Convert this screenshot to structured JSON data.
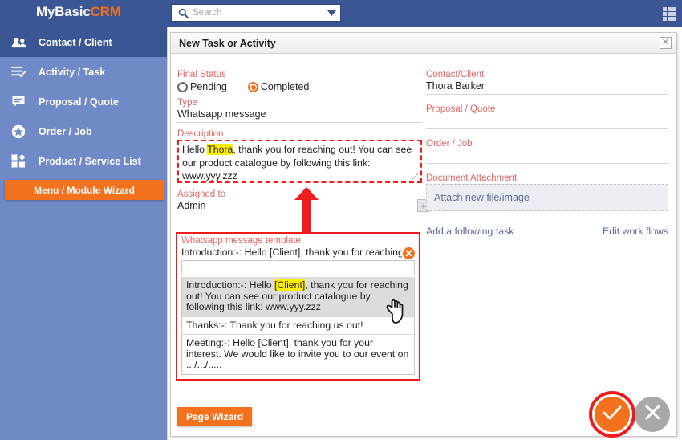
{
  "topbar": {
    "brand_my": "MyBasic",
    "brand_crm": "CRM",
    "search_placeholder": "Search",
    "search_value": "",
    "search_icon": "search-icon",
    "caret_icon": "chevron-down-icon",
    "apps_icon": "grid-apps-icon",
    "bg_color": "#3a5694",
    "accent_color": "#f2711c"
  },
  "sidebar": {
    "bg_color": "#7089c7",
    "active_color": "#3a5694",
    "items": [
      {
        "label": "Contact / Client",
        "icon": "people-icon",
        "active": true
      },
      {
        "label": "Activity / Task",
        "icon": "checklist-icon",
        "active": false
      },
      {
        "label": "Proposal / Quote",
        "icon": "chat-icon",
        "active": false
      },
      {
        "label": "Order / Job",
        "icon": "star-badge-icon",
        "active": false
      },
      {
        "label": "Product / Service List",
        "icon": "blocks-icon",
        "active": false
      }
    ],
    "wizard_button": "Menu / Module Wizard"
  },
  "panel": {
    "title": "New Task or Activity",
    "close_icon": "close-icon"
  },
  "form": {
    "final_status": {
      "label": "Final Status",
      "options": [
        {
          "label": "Pending",
          "selected": false
        },
        {
          "label": "Completed",
          "selected": true
        }
      ]
    },
    "type": {
      "label": "Type",
      "value": "Whatsapp message"
    },
    "description": {
      "label": "Description",
      "before_hl": "Hello ",
      "highlight": "Thora",
      "after_hl": ", thank you for reaching out! You can see our product catalogue by following this link: www.yyy.zzz",
      "highlight_color": "#fff000",
      "annotation_color": "#ee1c1c"
    },
    "assigned_to": {
      "label": "Assigned to",
      "value": "Admin",
      "add_icon": "plus-icon"
    },
    "contact_client": {
      "label": "Contact/Client",
      "value": "Thora Barker"
    },
    "proposal_quote": {
      "label": "Proposal / Quote",
      "value": ""
    },
    "order_job": {
      "label": "Order / Job",
      "value": ""
    },
    "document_attachment": {
      "label": "Document Attachment",
      "value": "Attach new file/image"
    },
    "links": {
      "add_following_task": "Add a following task",
      "edit_work_flows": "Edit work flows"
    }
  },
  "template_dropdown": {
    "label": "Whatsapp message template",
    "selected_text": "Introduction:-: Hello [Client], thank you for reaching",
    "filter_value": "",
    "close_icon": "close-circle-icon",
    "cursor_icon": "hand-pointer-icon",
    "border_color": "#ee1c1c",
    "options": [
      {
        "before_hl": "Introduction:-: Hello ",
        "highlight": "[Client]",
        "after_hl": ", thank you for reaching out! You can see our product catalogue by following this link: www.yyy.zzz",
        "selected": true
      },
      {
        "before_hl": "Thanks:-: Thank you for reaching us out!",
        "highlight": "",
        "after_hl": "",
        "selected": false
      },
      {
        "before_hl": "Meeting:-: Hello [Client], thank you for your interest. We would like to invite you to our event on .../.../.....",
        "highlight": "",
        "after_hl": "",
        "selected": false
      }
    ]
  },
  "footer": {
    "page_wizard": "Page Wizard",
    "confirm_icon": "check-icon",
    "cancel_icon": "close-x-icon",
    "confirm_color": "#f2711c",
    "cancel_color": "#a8a8a8",
    "highlight_ring_color": "#ee1c1c"
  }
}
